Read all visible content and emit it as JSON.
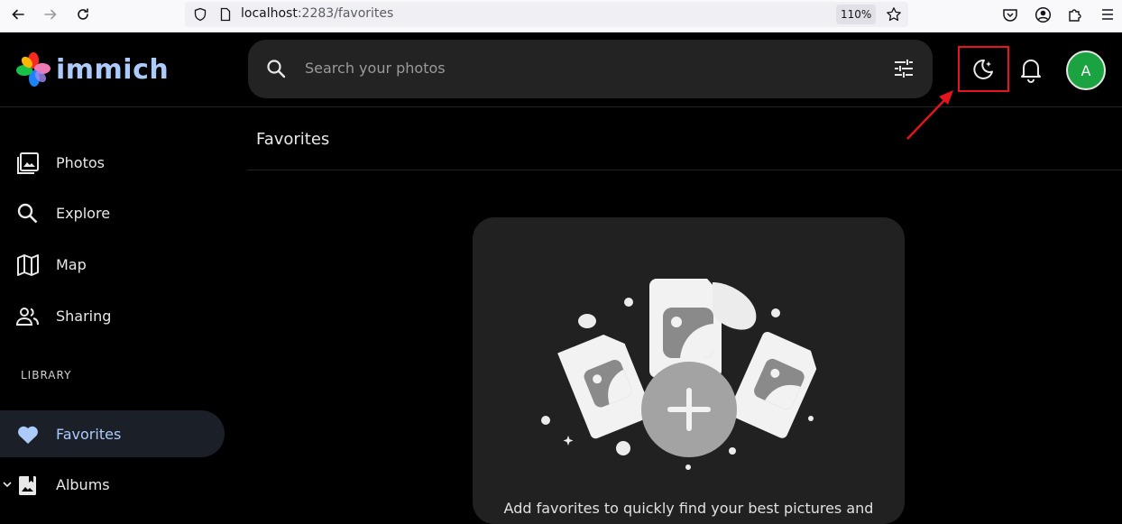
{
  "browser": {
    "url_host": "localhost",
    "url_path": ":2283/favorites",
    "zoom": "110%"
  },
  "header": {
    "logo_text": "immich",
    "search_placeholder": "Search your photos",
    "avatar_initial": "A"
  },
  "sidebar": {
    "items": [
      {
        "label": "Photos",
        "icon": "photos-icon"
      },
      {
        "label": "Explore",
        "icon": "search-icon"
      },
      {
        "label": "Map",
        "icon": "map-icon"
      },
      {
        "label": "Sharing",
        "icon": "people-icon"
      }
    ],
    "library_label": "LIBRARY",
    "library_items": [
      {
        "label": "Favorites",
        "icon": "heart-icon",
        "active": true
      },
      {
        "label": "Albums",
        "icon": "album-icon"
      }
    ]
  },
  "main": {
    "title": "Favorites",
    "empty_message": "Add favorites to quickly find your best pictures and"
  },
  "colors": {
    "accent": "#adcbfa",
    "avatar_bg": "#1aa340",
    "highlight": "#e5141f"
  }
}
